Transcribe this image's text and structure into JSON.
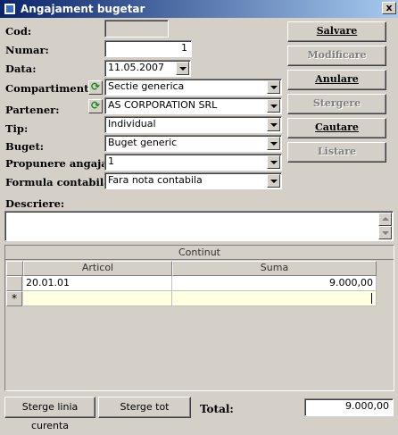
{
  "window": {
    "title": "Angajament bugetar",
    "close_label": "x"
  },
  "form": {
    "cod": {
      "label": "Cod:",
      "value": ""
    },
    "numar": {
      "label": "Numar:",
      "value": "1"
    },
    "data": {
      "label": "Data:",
      "value": "11.05.2007"
    },
    "compartiment": {
      "label": "Compartiment:",
      "value": "Sectie generica"
    },
    "partener": {
      "label": "Partener:",
      "value": "AS CORPORATION SRL"
    },
    "tip": {
      "label": "Tip:",
      "value": "Individual"
    },
    "buget": {
      "label": "Buget:",
      "value": "Buget generic"
    },
    "propunere": {
      "label": "Propunere angajare:",
      "value": "1"
    },
    "formula": {
      "label": "Formula contabila:",
      "value": "Fara nota contabila"
    },
    "descriere": {
      "label": "Descriere:",
      "value": ""
    }
  },
  "buttons": {
    "salvare": "Salvare",
    "modificare": "Modificare",
    "anulare": "Anulare",
    "stergere": "Stergere",
    "cautare": "Cautare",
    "listare": "Listare"
  },
  "grid": {
    "caption": "Continut",
    "columns": [
      "Articol",
      "Suma"
    ],
    "rows": [
      {
        "articol": "20.01.01",
        "suma": "9.000,00"
      }
    ],
    "new_row_marker": "*"
  },
  "footer": {
    "sterge_linia": "Sterge linia curenta",
    "sterge_tot": "Sterge tot",
    "total_label": "Total:",
    "total_value": "9.000,00"
  },
  "icons": {
    "refresh": "refresh-icon",
    "dropdown": "chevron-down-icon"
  },
  "colors": {
    "titlebar_start": "#0a246a",
    "titlebar_end": "#a6caf0",
    "new_row_bg": "#ffffe1",
    "refresh_green": "#1a8a1a"
  }
}
